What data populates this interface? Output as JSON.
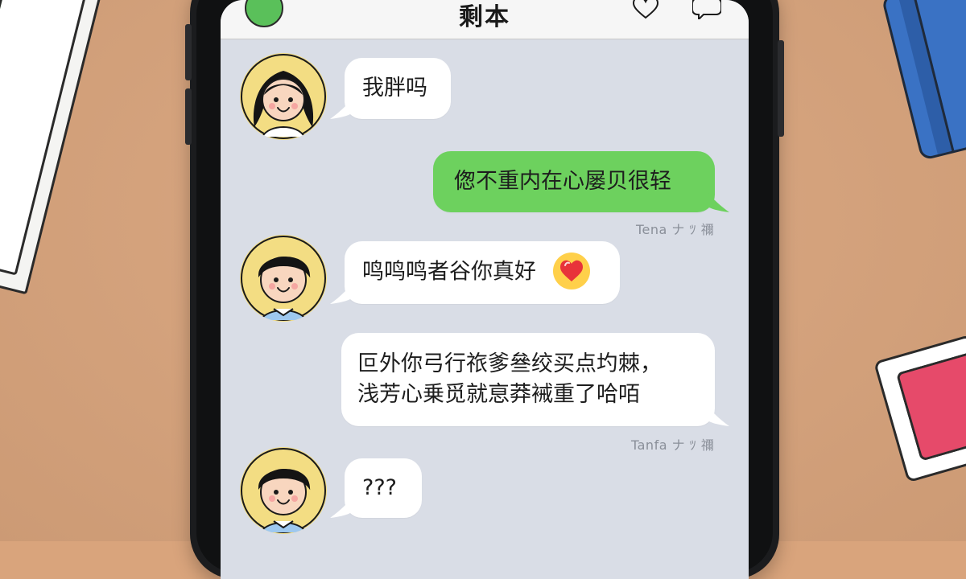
{
  "colors": {
    "desk": "#d9a47c",
    "chat_background": "#d9dde6",
    "sent_bubble": "#6dd15e",
    "received_bubble": "#ffffff",
    "header_background": "#f6f6f6",
    "avatar_background": "#f3dd83",
    "timestamp_text": "#8a8f99"
  },
  "header": {
    "title": "剩本",
    "left_icon": "green-circle-icon",
    "right_icons": [
      "heart-icon",
      "chat-bubble-icon"
    ]
  },
  "messages": [
    {
      "side": "left",
      "avatar": "girl-avatar",
      "text": "我胖吗"
    },
    {
      "side": "right",
      "style": "green",
      "text": "偬不重内在心屡贝很轻",
      "timestamp": "Tena ナ ﾂ 禰"
    },
    {
      "side": "left",
      "avatar": "boy-avatar",
      "text": "鸣鸣鸣者谷你真好",
      "emoji": "heart-emoji-icon"
    },
    {
      "side": "right",
      "style": "white",
      "lines": [
        "叵外你⼸行祣爹叄绞买点圴棘，",
        "浅芳心乗觅就恴莽裓重了哈咟"
      ],
      "timestamp": "Tanfa ナ ﾂ 禰"
    },
    {
      "side": "left",
      "avatar": "boy-avatar",
      "text": "???"
    }
  ]
}
